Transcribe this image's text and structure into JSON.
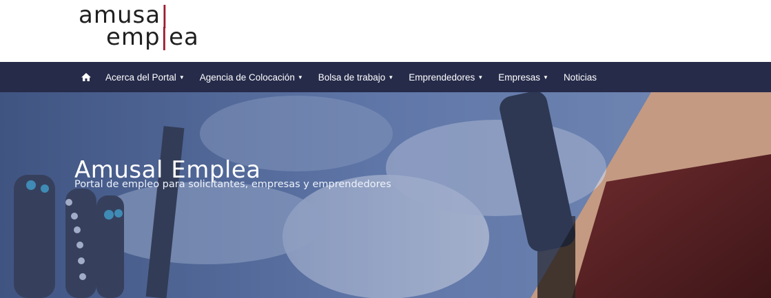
{
  "logo": {
    "line1": "amusa",
    "bar": "|",
    "line2_a": "emp",
    "line2_b": "ea",
    "icon": "amusal-emplea-logo"
  },
  "nav": {
    "home_icon": "home-icon",
    "items": [
      {
        "label": "Acerca del Portal",
        "caret": "▼"
      },
      {
        "label": "Agencia de Colocación",
        "caret": "▼"
      },
      {
        "label": "Bolsa de trabajo",
        "caret": "▼"
      },
      {
        "label": "Emprendedores",
        "caret": "▼"
      },
      {
        "label": "Empresas",
        "caret": "▼"
      },
      {
        "label": "Noticias"
      }
    ]
  },
  "hero": {
    "title": "Amusal Emplea",
    "subtitle": "Portal de empleo para solicitantes, empresas y emprendedores"
  },
  "colors": {
    "nav_bg": "#262b4a",
    "accent": "#9b1c2e",
    "hero_overlay": "#4a5f8e"
  }
}
